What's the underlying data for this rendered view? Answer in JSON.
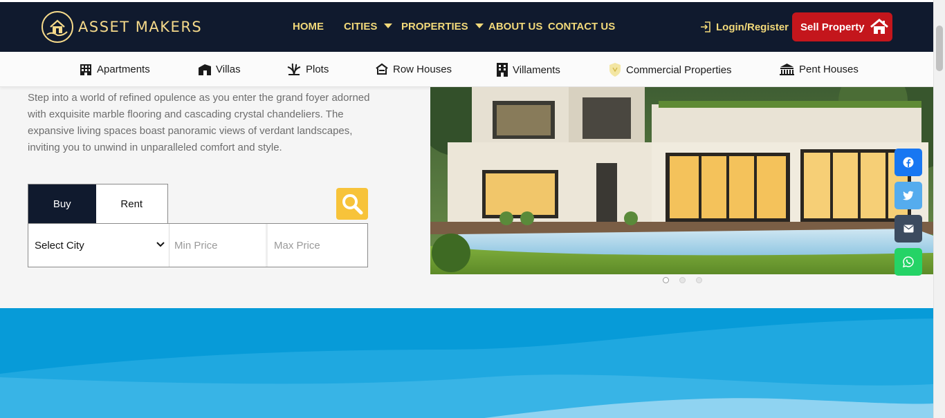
{
  "brand": {
    "name": "ASSET MAKERS"
  },
  "nav": {
    "home": "HOME",
    "cities": "CITIES",
    "properties": "PROPERTIES",
    "about": "ABOUT US",
    "contact": "CONTACT US",
    "login": "Login/Register",
    "sell": "Sell Property"
  },
  "categories": [
    {
      "label": "Apartments",
      "icon": "building-icon"
    },
    {
      "label": "Villas",
      "icon": "villa-icon"
    },
    {
      "label": "Plots",
      "icon": "plot-icon"
    },
    {
      "label": "Row Houses",
      "icon": "row-house-icon"
    },
    {
      "label": "Villaments",
      "icon": "villament-icon"
    },
    {
      "label": "Commercial Properties",
      "icon": "commercial-shield-icon"
    },
    {
      "label": "Pent Houses",
      "icon": "penthouse-icon"
    }
  ],
  "intro": {
    "text": "Step into a world of refined opulence as you enter the grand foyer adorned with exquisite marble flooring and cascading crystal chandeliers. The expansive living spaces boast panoramic views of verdant landscapes, inviting you to unwind in unparalleled comfort and style."
  },
  "search": {
    "tab_buy": "Buy",
    "tab_rent": "Rent",
    "active_tab": "Buy",
    "city_selected": "Select City",
    "min_price_placeholder": "Min Price",
    "max_price_placeholder": "Max Price"
  },
  "carousel": {
    "slide_count": 3,
    "active_index": 0
  },
  "share": [
    {
      "icon": "facebook-icon",
      "color": "#1877f2"
    },
    {
      "icon": "twitter-icon",
      "color": "#55acee"
    },
    {
      "icon": "email-icon",
      "color": "#3c4b5f"
    },
    {
      "icon": "whatsapp-icon",
      "color": "#25d366"
    }
  ],
  "colors": {
    "header_bg": "#101a2e",
    "nav_text": "#f2d97a",
    "sell_button": "#c4161c",
    "search_button": "#f7c33a",
    "wave": "#079bd8"
  }
}
